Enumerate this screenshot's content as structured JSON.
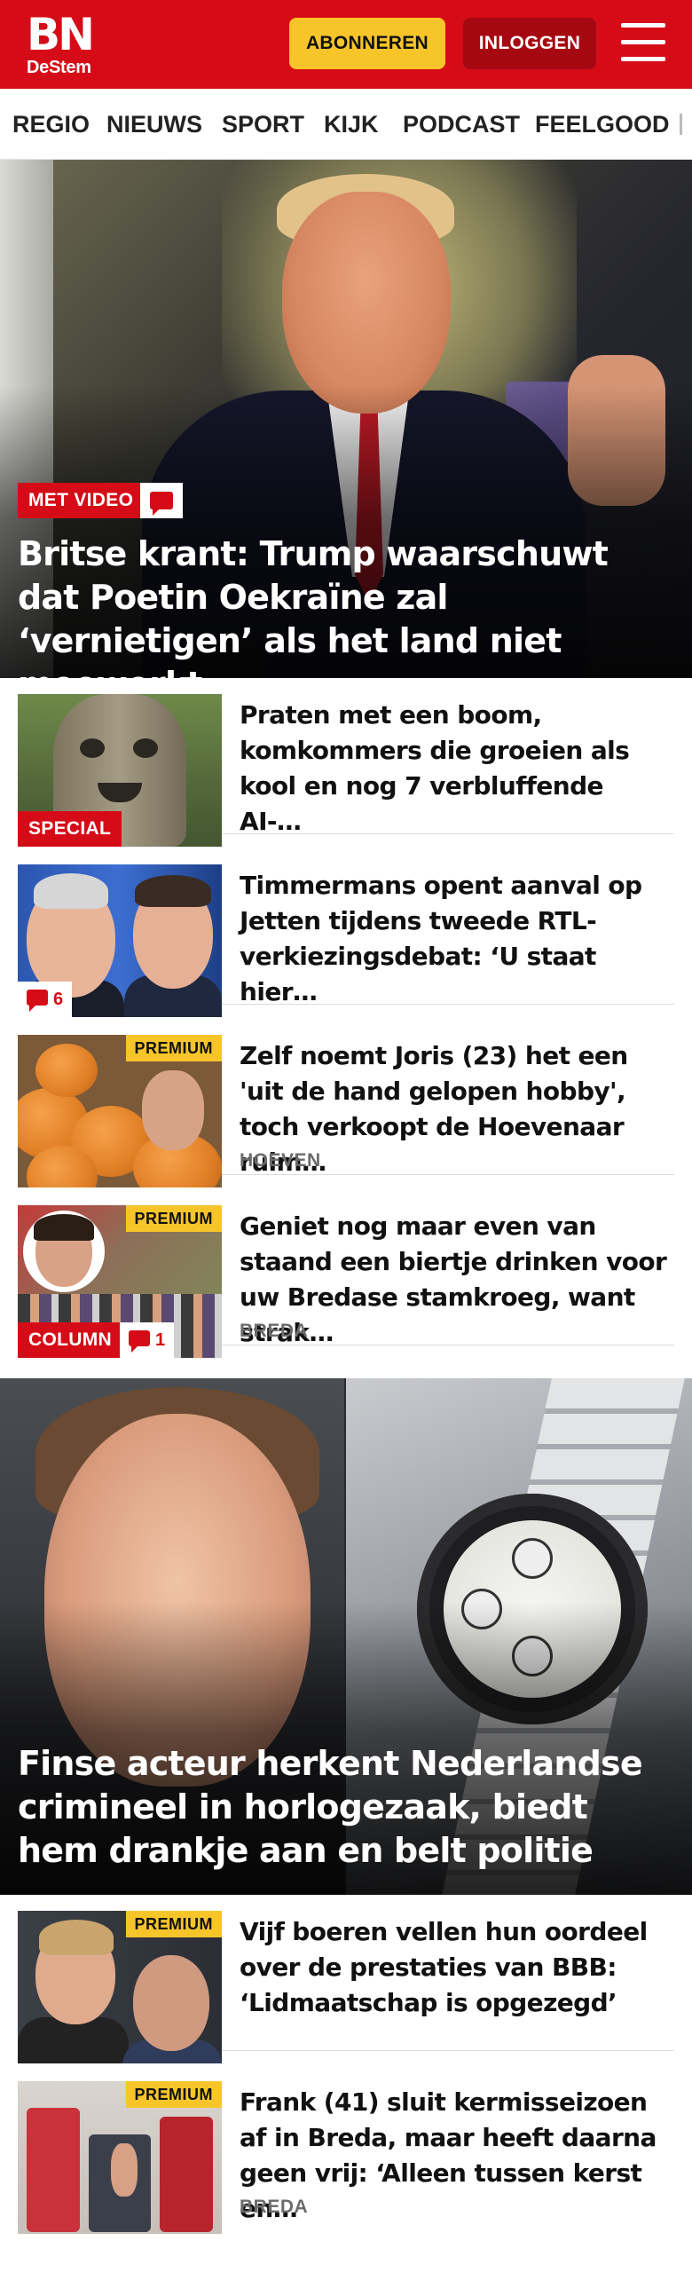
{
  "header": {
    "logo_main": "BN",
    "logo_sub": "DeStem",
    "subscribe_label": "ABONNEREN",
    "login_label": "INLOGGEN",
    "menu_icon": "hamburger-menu-icon"
  },
  "nav": {
    "items": [
      "REGIO",
      "NIEUWS",
      "SPORT",
      "KIJK",
      "PODCAST",
      "FEELGOOD"
    ]
  },
  "hero1": {
    "label": "MET VIDEO",
    "title": "Britse krant: Trump waarschuwt dat Poetin Oekraïne zal ‘vernietigen’ als het land niet meewerkt"
  },
  "articles": [
    {
      "title": "Praten met een boom, komkommers die groeien als kool en nog 7 verbluffende AI-…",
      "label": "SPECIAL"
    },
    {
      "title": "Timmermans opent aanval op Jetten tijdens tweede RTL-verkiezingsdebat: ‘U staat hier…",
      "comments": "6"
    },
    {
      "title": "Zelf noemt Joris (23) het een 'uit de hand gelopen hobby', toch verkoopt de Hoevenaar ruim…",
      "badge": "PREMIUM",
      "location": "HOEVEN"
    },
    {
      "title": "Geniet nog maar even van staand een biertje drinken voor uw Bredase stamkroeg, want strak…",
      "badge": "PREMIUM",
      "label": "COLUMN",
      "comments": "1",
      "location": "BREDA"
    }
  ],
  "hero2": {
    "title": "Finse acteur herkent Nederlandse crimineel in horlogezaak, biedt hem drankje aan en belt politie"
  },
  "articles2": [
    {
      "title": "Vijf boeren vellen hun oordeel over de prestaties van BBB: ‘Lidmaatschap is opgezegd’",
      "badge": "PREMIUM"
    },
    {
      "title": "Frank (41) sluit kermisseizoen af in Breda, maar heeft daarna geen vrij: ‘Alleen tussen kerst en…",
      "badge": "PREMIUM",
      "location": "BREDA"
    }
  ],
  "colors": {
    "brand_red": "#d50c17",
    "login_dark_red": "#a60812",
    "subscribe_yellow": "#f7c52a",
    "premium_yellow": "#f7c52a",
    "location_gray": "#6b6b6b"
  }
}
